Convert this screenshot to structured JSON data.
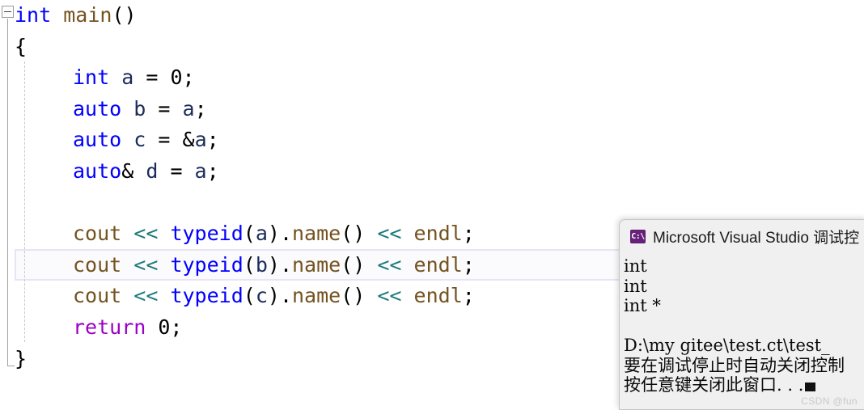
{
  "editor": {
    "background": "#ffffff",
    "font_size_px": 25,
    "current_line_index": 8,
    "current_line_highlight_color": "#e6e4f5",
    "outline": {
      "collapse_icon": "collapse-minus-icon",
      "collapsed": false
    },
    "colors": {
      "keyword": "#0000ff",
      "keyword_control": "#9b00c8",
      "identifier": "#1c2b5a",
      "function": "#74531f",
      "operator": "#1f7a7a",
      "punctuation": "#000000"
    },
    "lines": [
      {
        "indent": 0,
        "tokens": [
          {
            "t": "int",
            "c": "kw"
          },
          {
            "t": " ",
            "c": "punc"
          },
          {
            "t": "main",
            "c": "fn"
          },
          {
            "t": "()",
            "c": "punc"
          }
        ]
      },
      {
        "indent": 0,
        "tokens": [
          {
            "t": "{",
            "c": "punc"
          }
        ]
      },
      {
        "indent": 1,
        "tokens": [
          {
            "t": "int",
            "c": "kw"
          },
          {
            "t": " ",
            "c": "punc"
          },
          {
            "t": "a",
            "c": "ident"
          },
          {
            "t": " = ",
            "c": "punc"
          },
          {
            "t": "0",
            "c": "punc"
          },
          {
            "t": ";",
            "c": "punc"
          }
        ]
      },
      {
        "indent": 1,
        "tokens": [
          {
            "t": "auto",
            "c": "kw"
          },
          {
            "t": " ",
            "c": "punc"
          },
          {
            "t": "b",
            "c": "ident"
          },
          {
            "t": " = ",
            "c": "punc"
          },
          {
            "t": "a",
            "c": "ident"
          },
          {
            "t": ";",
            "c": "punc"
          }
        ]
      },
      {
        "indent": 1,
        "tokens": [
          {
            "t": "auto",
            "c": "kw"
          },
          {
            "t": " ",
            "c": "punc"
          },
          {
            "t": "c",
            "c": "ident"
          },
          {
            "t": " = &",
            "c": "punc"
          },
          {
            "t": "a",
            "c": "ident"
          },
          {
            "t": ";",
            "c": "punc"
          }
        ]
      },
      {
        "indent": 1,
        "tokens": [
          {
            "t": "auto",
            "c": "kw"
          },
          {
            "t": "& ",
            "c": "punc"
          },
          {
            "t": "d",
            "c": "ident"
          },
          {
            "t": " = ",
            "c": "punc"
          },
          {
            "t": "a",
            "c": "ident"
          },
          {
            "t": ";",
            "c": "punc"
          }
        ]
      },
      {
        "indent": 1,
        "tokens": []
      },
      {
        "indent": 1,
        "tokens": [
          {
            "t": "cout",
            "c": "fn"
          },
          {
            "t": " ",
            "c": "punc"
          },
          {
            "t": "<<",
            "c": "op"
          },
          {
            "t": " ",
            "c": "punc"
          },
          {
            "t": "typeid",
            "c": "kw"
          },
          {
            "t": "(",
            "c": "punc"
          },
          {
            "t": "a",
            "c": "ident"
          },
          {
            "t": ").",
            "c": "punc"
          },
          {
            "t": "name",
            "c": "fn"
          },
          {
            "t": "() ",
            "c": "punc"
          },
          {
            "t": "<<",
            "c": "op"
          },
          {
            "t": " ",
            "c": "punc"
          },
          {
            "t": "endl",
            "c": "fn"
          },
          {
            "t": ";",
            "c": "punc"
          }
        ]
      },
      {
        "indent": 1,
        "tokens": [
          {
            "t": "cout",
            "c": "fn"
          },
          {
            "t": " ",
            "c": "punc"
          },
          {
            "t": "<<",
            "c": "op"
          },
          {
            "t": " ",
            "c": "punc"
          },
          {
            "t": "typeid",
            "c": "kw"
          },
          {
            "t": "(",
            "c": "punc"
          },
          {
            "t": "b",
            "c": "ident"
          },
          {
            "t": ").",
            "c": "punc"
          },
          {
            "t": "name",
            "c": "fn"
          },
          {
            "t": "() ",
            "c": "punc"
          },
          {
            "t": "<<",
            "c": "op"
          },
          {
            "t": " ",
            "c": "punc"
          },
          {
            "t": "endl",
            "c": "fn"
          },
          {
            "t": ";",
            "c": "punc"
          }
        ]
      },
      {
        "indent": 1,
        "tokens": [
          {
            "t": "cout",
            "c": "fn"
          },
          {
            "t": " ",
            "c": "punc"
          },
          {
            "t": "<<",
            "c": "op"
          },
          {
            "t": " ",
            "c": "punc"
          },
          {
            "t": "typeid",
            "c": "kw"
          },
          {
            "t": "(",
            "c": "punc"
          },
          {
            "t": "c",
            "c": "ident"
          },
          {
            "t": ").",
            "c": "punc"
          },
          {
            "t": "name",
            "c": "fn"
          },
          {
            "t": "() ",
            "c": "punc"
          },
          {
            "t": "<<",
            "c": "op"
          },
          {
            "t": " ",
            "c": "punc"
          },
          {
            "t": "endl",
            "c": "fn"
          },
          {
            "t": ";",
            "c": "punc"
          }
        ]
      },
      {
        "indent": 1,
        "tokens": [
          {
            "t": "return",
            "c": "kw2"
          },
          {
            "t": " 0;",
            "c": "punc"
          }
        ]
      },
      {
        "indent": 0,
        "tokens": [
          {
            "t": "}",
            "c": "punc"
          }
        ]
      }
    ]
  },
  "console": {
    "title": "Microsoft Visual Studio 调试控",
    "icon": "console-window-icon",
    "icon_glyph": "C:\\",
    "icon_color": "#68217a",
    "background": "#f0f0f0",
    "output_lines": [
      "int",
      "int",
      "int *",
      "",
      "D:\\my gitee\\test.ct\\test_",
      "要在调试停止时自动关闭控制",
      "按任意键关闭此窗口. . ."
    ],
    "cursor_visible": true
  },
  "watermark": {
    "text": "CSDN @fun"
  }
}
